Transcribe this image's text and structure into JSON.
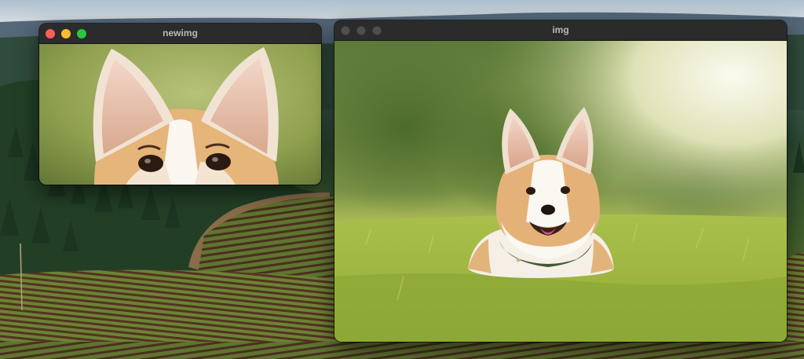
{
  "desktop": {
    "wallpaper": "vineyard-hills"
  },
  "windows": [
    {
      "title": "newimg",
      "state": "active",
      "content": "cropped-corgi-ears-image"
    },
    {
      "title": "img",
      "state": "inactive",
      "content": "corgi-in-grass-image"
    }
  ],
  "colors": {
    "close": "#ff5f57",
    "minimize": "#febc2e",
    "zoom": "#28c840",
    "inactive_button": "#4f4f4f",
    "titlebar": "#2b2b2b"
  }
}
